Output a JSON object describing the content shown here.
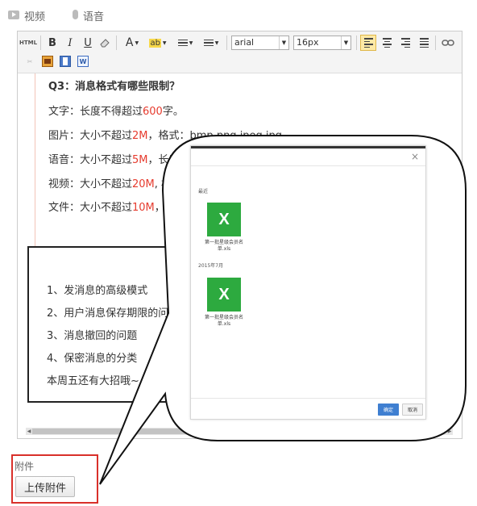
{
  "tabs": [
    {
      "label": "视频",
      "icon": "video-icon"
    },
    {
      "label": "语音",
      "icon": "microphone-icon"
    }
  ],
  "toolbar": {
    "html_label": "HTML",
    "bold": "B",
    "italic": "I",
    "underline": "U",
    "font_color": "A",
    "font_family": "arial",
    "font_size": "16px"
  },
  "content": {
    "heading": "Q3：消息格式有哪些限制？",
    "lines": [
      {
        "pre": "文字：长度不得超过",
        "hl": "600",
        "post": "字。"
      },
      {
        "pre": "图片：大小不超过",
        "hl": "2M",
        "post": "，格式：bmp,png,jpeg,jpg。"
      },
      {
        "pre": "语音：大小不超过",
        "hl": "5M",
        "post": "，长度不"
      },
      {
        "pre": "视频：大小不超过",
        "hl": "20M",
        "post": ", 格"
      },
      {
        "pre": "文件：大小不超过",
        "hl": "10M",
        "post": "，格"
      }
    ]
  },
  "announce": {
    "items": [
      "1、发消息的高级模式",
      "2、用户消息保存期限的问",
      "3、消息撤回的问题",
      "4、保密消息的分类",
      "本周五还有大招哦~"
    ]
  },
  "attachment": {
    "label": "附件",
    "upload_button": "上传附件"
  },
  "dialog": {
    "close": "×",
    "sections": [
      {
        "title": "最近",
        "files": [
          {
            "icon_letter": "X",
            "name": "第一批星级会员名单.xls"
          }
        ]
      },
      {
        "title": "2015年7月",
        "files": [
          {
            "icon_letter": "X",
            "name": "第一批星级会员名单.xls"
          }
        ]
      }
    ],
    "ok_button": "确定",
    "cancel_button": "取消"
  },
  "colors": {
    "highlight": "#e63b2e",
    "excel": "#2daa3f",
    "primary": "#3f7fd1",
    "attach_border": "#d9302a"
  }
}
